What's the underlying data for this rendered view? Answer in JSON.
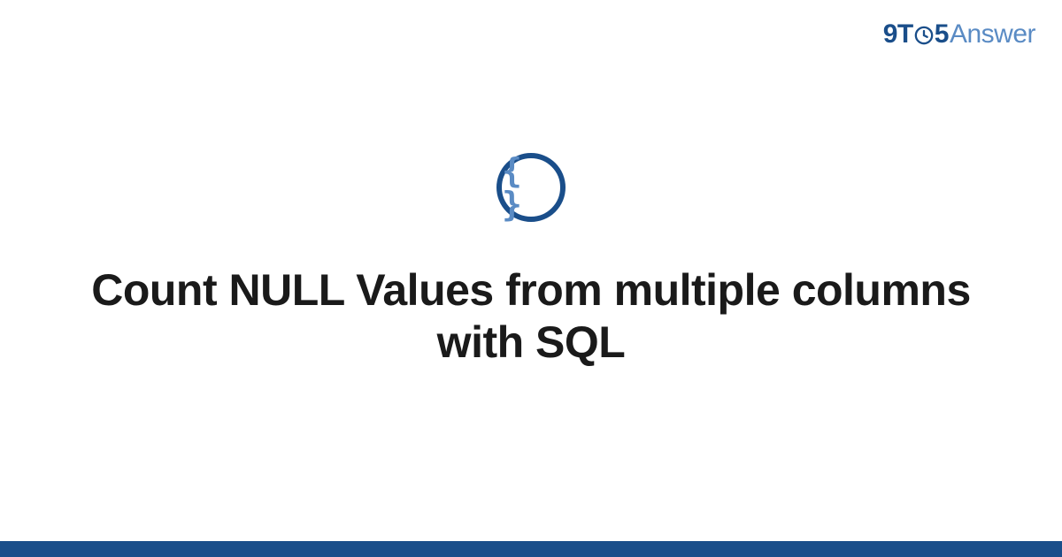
{
  "logo": {
    "prefix": "9T",
    "suffix": "5",
    "word": "Answer"
  },
  "icon": {
    "glyph": "{ }",
    "name": "code-braces"
  },
  "title": "Count NULL Values from multiple columns with SQL",
  "colors": {
    "primary": "#1a4e8a",
    "secondary": "#5a8bc4"
  }
}
